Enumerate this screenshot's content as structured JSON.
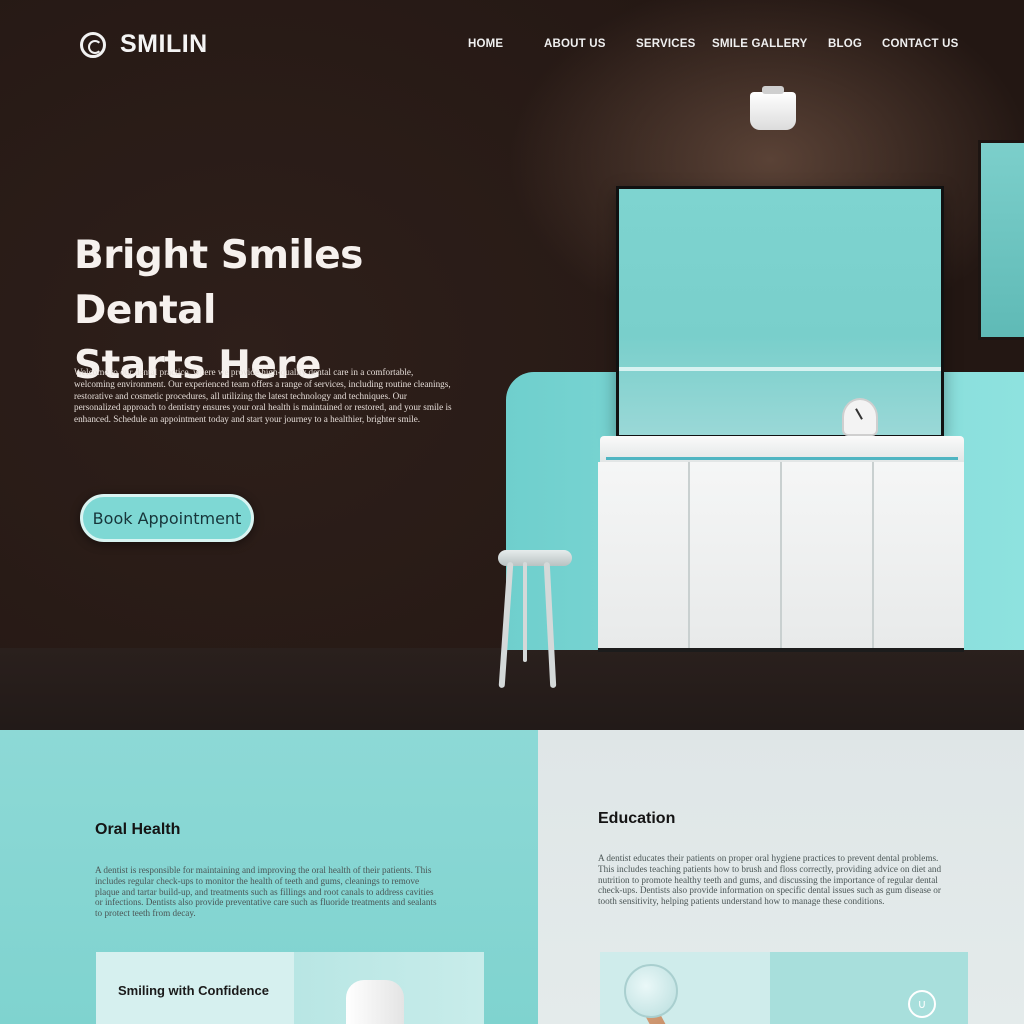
{
  "brand": {
    "name": "SMILIN",
    "logo_icon": "tooth-swirl-icon"
  },
  "nav": {
    "items": [
      {
        "label": "HOME"
      },
      {
        "label": "ABOUT US"
      },
      {
        "label": "SERVICES"
      },
      {
        "label": "SMILE GALLERY"
      },
      {
        "label": "BLOG"
      },
      {
        "label": "CONTACT US"
      }
    ]
  },
  "hero": {
    "title_line1": "Bright Smiles Dental",
    "title_line2": "Starts Here",
    "description": "Welcome to our dental practice, where we provide high-quality dental care in a comfortable, welcoming environment. Our experienced team offers a range of services, including routine cleanings, restorative and cosmetic procedures, all utilizing the latest technology and techniques. Our personalized approach to dentistry ensures your oral health is maintained or restored, and your smile is enhanced. Schedule an appointment today and start your journey to a healthier, brighter smile.",
    "cta_label": "Book Appointment"
  },
  "sections": {
    "oral_health": {
      "title": "Oral Health",
      "text": "A dentist is responsible for maintaining and improving the oral health of their patients. This includes regular check-ups to monitor the health of teeth and gums, cleanings to remove plaque and tartar build-up, and treatments such as fillings and root canals to address cavities or infections. Dentists also provide preventative care such as fluoride treatments and sealants to protect teeth from decay.",
      "card_label": "Smiling with Confidence"
    },
    "education": {
      "title": "Education",
      "text": "A dentist educates their patients on proper oral hygiene practices to prevent dental problems. This includes teaching patients how to brush and floss correctly, providing advice on diet and nutrition to promote healthy teeth and gums, and discussing the importance of regular dental check-ups. Dentists also provide information on specific dental issues such as gum disease or tooth sensitivity, helping patients understand how to manage these conditions.",
      "card_icon": "tooth-badge-icon"
    }
  },
  "colors": {
    "hero_bg": "#231713",
    "accent_teal": "#7ed8d4",
    "light_panel": "#e2e9ea",
    "text_light": "#f6f1ee"
  }
}
